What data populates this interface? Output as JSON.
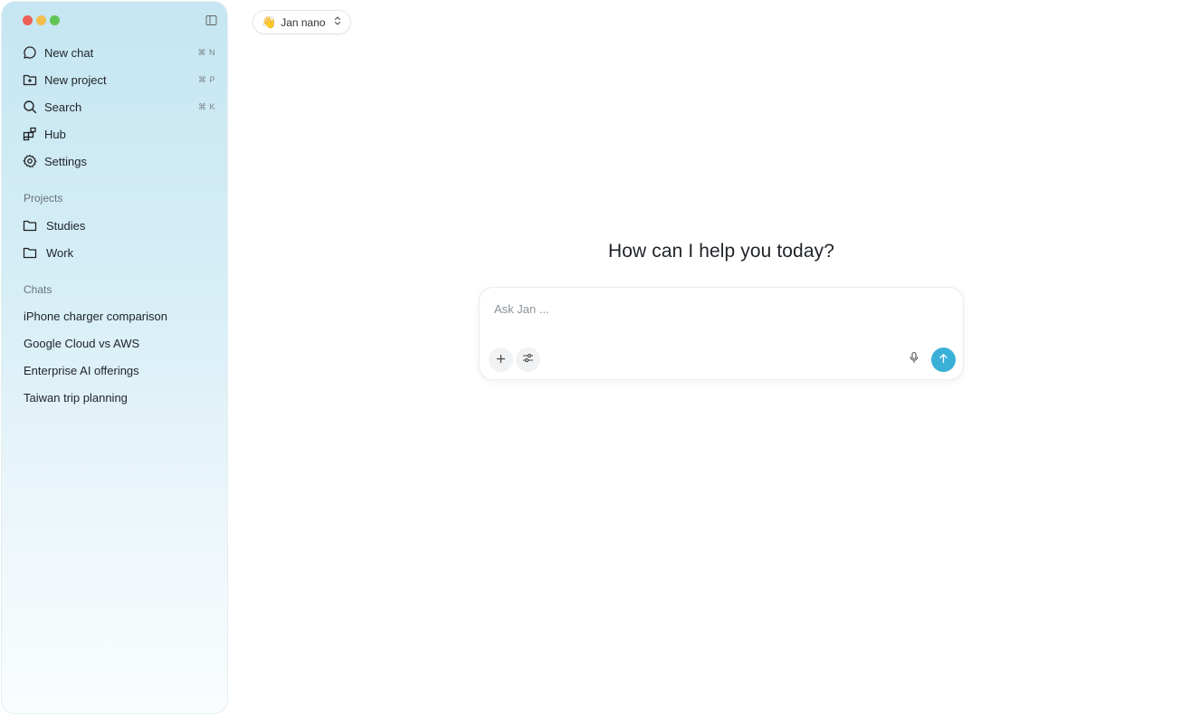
{
  "sidebar": {
    "nav": [
      {
        "label": "New chat",
        "shortcut": "⌘ N",
        "icon": "chat-bubble-icon"
      },
      {
        "label": "New project",
        "shortcut": "⌘ P",
        "icon": "folder-plus-icon"
      },
      {
        "label": "Search",
        "shortcut": "⌘ K",
        "icon": "search-icon"
      },
      {
        "label": "Hub",
        "shortcut": "",
        "icon": "grid-icon"
      },
      {
        "label": "Settings",
        "shortcut": "",
        "icon": "gear-icon"
      }
    ],
    "projects_title": "Projects",
    "projects": [
      {
        "label": "Studies",
        "icon": "folder-icon"
      },
      {
        "label": "Work",
        "icon": "folder-icon"
      }
    ],
    "chats_title": "Chats",
    "chats": [
      "iPhone charger comparison",
      "Google Cloud vs AWS",
      "Enterprise AI offerings",
      "Taiwan trip planning"
    ]
  },
  "header": {
    "model_emoji": "👋",
    "model_name": "Jan nano"
  },
  "main": {
    "headline": "How can I help you today?",
    "composer_placeholder": "Ask Jan ..."
  },
  "colors": {
    "accent": "#3ab0d8",
    "sidebar_top": "#c5e6f2",
    "traffic_red": "#ec5f57",
    "traffic_yellow": "#f4be4f",
    "traffic_green": "#5fc454"
  }
}
